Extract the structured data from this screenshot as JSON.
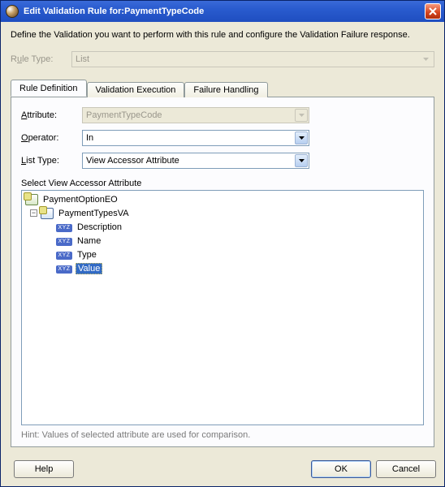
{
  "titlebar": {
    "prefix": "Edit Validation Rule for: ",
    "subject": "PaymentTypeCode"
  },
  "description": "Define the Validation you want to perform with this rule and configure the Validation Failure response.",
  "ruleType": {
    "label_pre": "R",
    "label_u": "u",
    "label_post": "le Type:",
    "value": "List"
  },
  "tabs": {
    "definition": "Rule Definition",
    "execution": "Validation Execution",
    "failure": "Failure Handling"
  },
  "form": {
    "attribute_label_u": "A",
    "attribute_label_post": "ttribute:",
    "attribute_value": "PaymentTypeCode",
    "operator_label_u": "O",
    "operator_label_post": "perator:",
    "operator_value": "In",
    "listtype_label_pre": "",
    "listtype_label_u": "L",
    "listtype_label_post": "ist Type:",
    "listtype_value": "View Accessor Attribute"
  },
  "tree": {
    "section_label": "Select View Accessor Attribute",
    "root": "PaymentOptionEO",
    "va": "PaymentTypesVA",
    "attrs": [
      "Description",
      "Name",
      "Type",
      "Value"
    ],
    "selected": "Value",
    "attr_badge": "XYZ"
  },
  "hint": "Hint: Values of selected attribute are used for comparison.",
  "buttons": {
    "help": "Help",
    "ok": "OK",
    "cancel": "Cancel"
  }
}
